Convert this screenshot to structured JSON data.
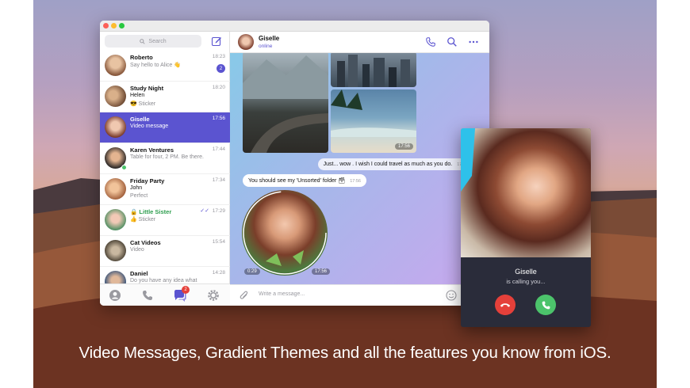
{
  "caption": "Video Messages, Gradient Themes and all the features you know from iOS.",
  "colors": {
    "accent": "#5b54d0",
    "decline": "#e5403a",
    "accept": "#4cc36b"
  },
  "sidebar": {
    "search_placeholder": "Search",
    "chats": [
      {
        "name": "Roberto",
        "line1": "Say hello to Alice 👋",
        "line2": "",
        "time": "18:23",
        "badge": "2",
        "avatar_color": "#c99b78"
      },
      {
        "name": "Study Night",
        "line1": "Helen",
        "line2": "😎 Sticker",
        "time": "18:20",
        "badge": "",
        "avatar_color": "#a7774f"
      },
      {
        "name": "Giselle",
        "line1": "Video message",
        "line2": "",
        "time": "17:56",
        "badge": "",
        "avatar_color": "#8e5040",
        "selected": true
      },
      {
        "name": "Karen Ventures",
        "line1": "Table for four, 2 PM. Be there.",
        "line2": "",
        "time": "17:44",
        "badge": "",
        "avatar_color": "#3d3a38"
      },
      {
        "name": "Friday Party",
        "line1": "John",
        "line2": "Perfect",
        "time": "17:34",
        "badge": "",
        "avatar_color": "#d59a6a"
      },
      {
        "name": "🔒 Little Sister",
        "line1": "👍 Sticker",
        "line2": "",
        "time": "17:29",
        "badge": "",
        "avatar_color": "#6aa57a",
        "secret": true
      },
      {
        "name": "Cat Videos",
        "line1": "Video",
        "line2": "",
        "time": "15:54",
        "badge": "",
        "avatar_color": "#7a7060"
      },
      {
        "name": "Daniel",
        "line1": "Do you have any idea what",
        "line2": "",
        "time": "14:28",
        "badge": "",
        "avatar_color": "#4c6e9a"
      }
    ],
    "tabs": [
      "contacts-tab",
      "calls-tab",
      "chats-tab",
      "settings-tab"
    ],
    "chats_badge": "2"
  },
  "conversation": {
    "name": "Giselle",
    "status": "online",
    "album_time": "17:56",
    "msg1": {
      "text": "Just... wow . I wish I could travel as much as you do.",
      "time": "17:56"
    },
    "msg2": {
      "text": "You should see my 'Unsorted' folder 🗃",
      "time": "17:56"
    },
    "video_duration": "0:29",
    "video_time": "17:56",
    "composer_placeholder": "Write a message..."
  },
  "call": {
    "name": "Giselle",
    "subtitle": "is calling you..."
  }
}
